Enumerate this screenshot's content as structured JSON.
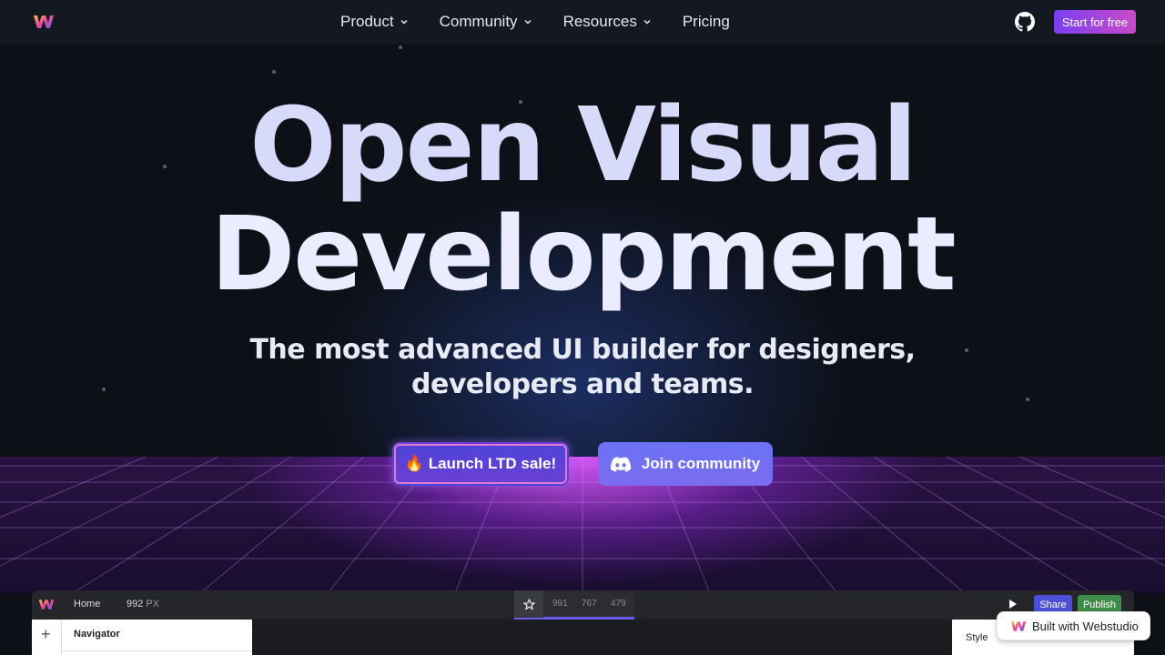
{
  "nav": {
    "links": [
      {
        "label": "Product",
        "has_dropdown": true
      },
      {
        "label": "Community",
        "has_dropdown": true
      },
      {
        "label": "Resources",
        "has_dropdown": true
      },
      {
        "label": "Pricing",
        "has_dropdown": false
      }
    ],
    "github_icon": "github-icon",
    "start_label": "Start for free"
  },
  "hero": {
    "line1": "Open Visual",
    "line2": "Development",
    "subtitle_line1": "The most advanced UI builder for designers,",
    "subtitle_line2": "developers and teams.",
    "launch_label": "🔥 Launch LTD sale!",
    "join_label": "Join community"
  },
  "builder": {
    "page": "Home",
    "width_value": "992",
    "width_unit": "PX",
    "breakpoints": [
      "991",
      "767",
      "479"
    ],
    "share_label": "Share",
    "publish_label": "Publish",
    "navigator_label": "Navigator",
    "style_tab": "Style"
  },
  "badge": {
    "label": "Built with Webstudio"
  },
  "colors": {
    "accent_start": "#7b3ef0",
    "accent_end": "#c94bc9",
    "share": "#4e4fd9",
    "publish": "#3e8c49"
  }
}
